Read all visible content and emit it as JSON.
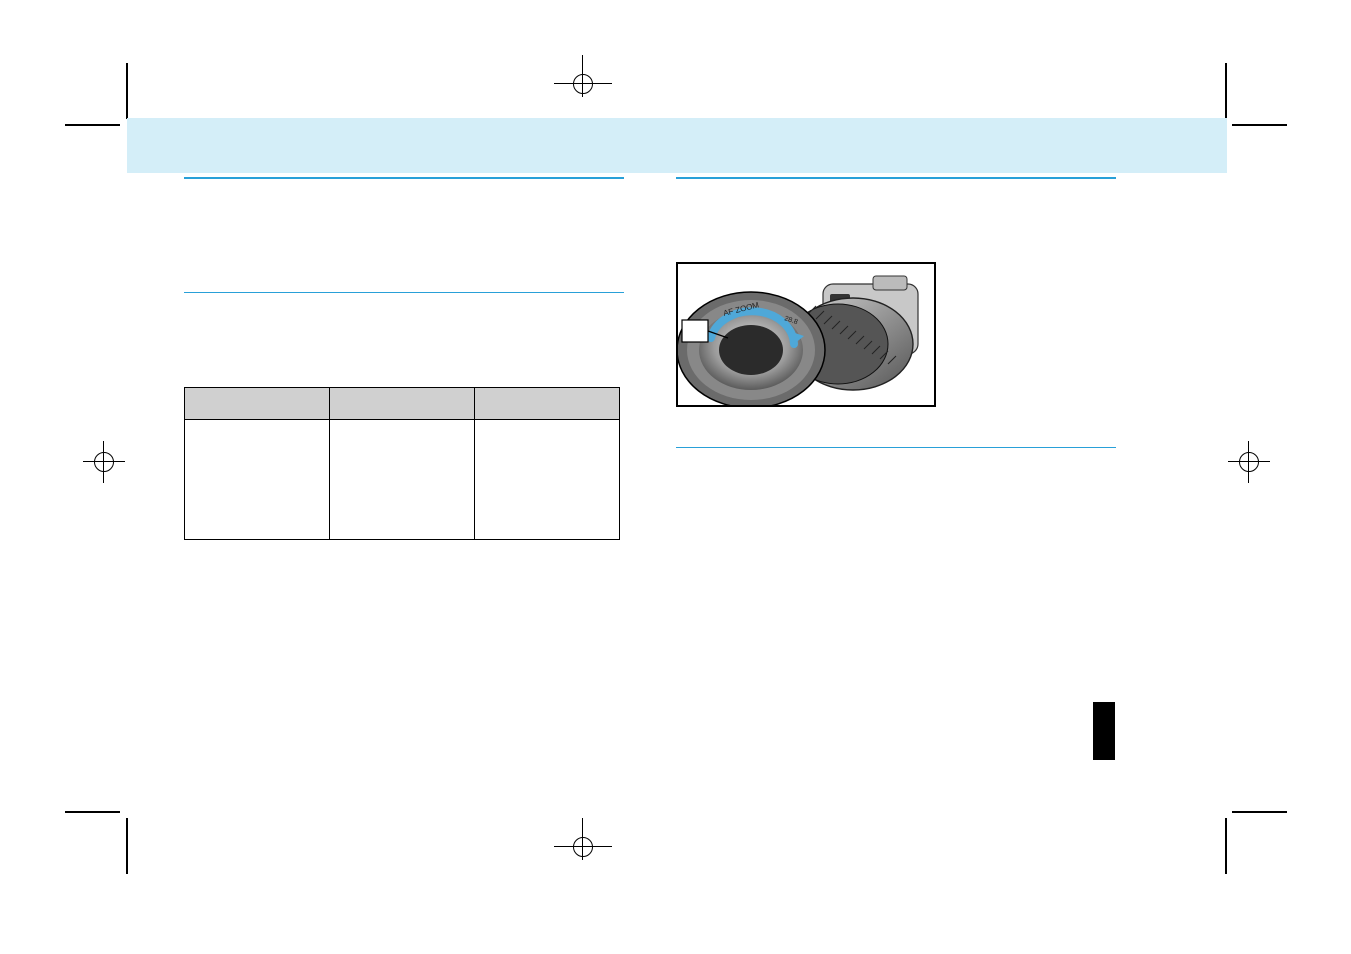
{
  "banner": {
    "title": ""
  },
  "left": {
    "heading1": "",
    "para1": "",
    "heading2": "",
    "para2": "",
    "table_caption": "",
    "table": {
      "headers": [
        "",
        "",
        ""
      ],
      "cells": [
        "",
        "",
        ""
      ]
    },
    "note": ""
  },
  "right": {
    "heading1": "",
    "para1": "",
    "fig_caption": "",
    "heading2": "",
    "para2": ""
  }
}
